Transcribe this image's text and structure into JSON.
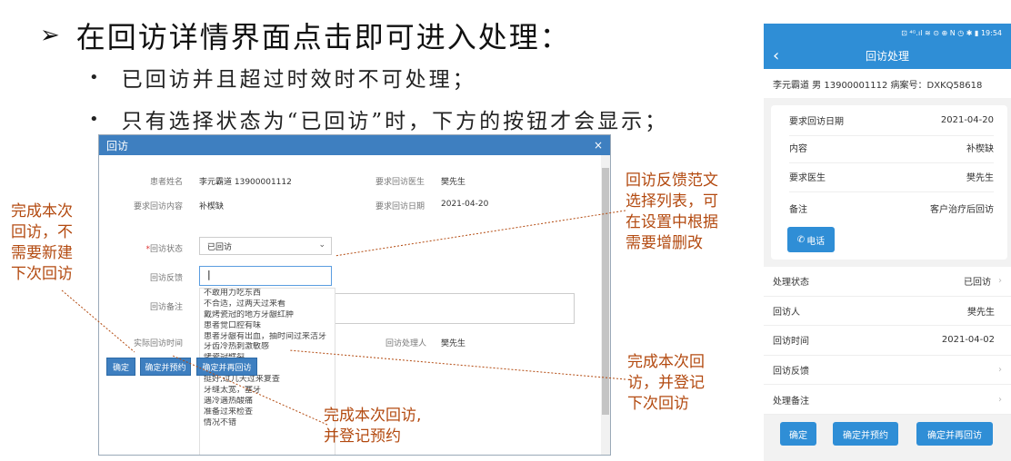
{
  "slide": {
    "heading_arrow": "➢",
    "heading": "在回访详情界面点击即可进入处理：",
    "bullet_symbol": "•",
    "bullets": [
      "已回访并且超过时效时不可处理；",
      "只有选择状态为“已回访”时，下方的按钮才会显示；"
    ]
  },
  "modal": {
    "title": "回访",
    "close": "×",
    "fields": {
      "patient_name_label": "患者姓名",
      "patient_name_value": "李元霸道 13900001112",
      "doctor_label": "要求回访医生",
      "doctor_value": "樊先生",
      "content_label": "要求回访内容",
      "content_value": "补楔缺",
      "date_label": "要求回访日期",
      "date_value": "2021-04-20",
      "status_required": "*",
      "status_label": "回访状态",
      "status_value": "已回访",
      "feedback_label": "回访反馈",
      "feedback_value": "|",
      "remark_label": "回访备注",
      "actual_time_label": "实际回访时间",
      "handler_label": "回访处理人",
      "handler_value": "樊先生"
    },
    "feedback_options": [
      "不敢用力吃东西",
      "不合适，过两天过来看",
      "戴烤瓷冠的地方牙龈红肿",
      "患者觉口腔有味",
      "患者牙龈有出血，抽时间过来洁牙",
      "牙齿冷热刺激敏感",
      "烤瓷冠劈裂",
      "稍微有点痛",
      "挺好,过几天过来复查",
      "牙缝太宽，塞牙",
      "遇冷遇热酸痛",
      "准备过来检查",
      "情况不错"
    ],
    "buttons": {
      "confirm": "确定",
      "confirm_schedule": "确定并预约",
      "confirm_again": "确定并再回访"
    }
  },
  "annotations": {
    "left": [
      "完成本次",
      "回访，不",
      "需要新建",
      "下次回访"
    ],
    "feedback": [
      "回访反馈范文",
      "选择列表，可",
      "在设置中根据",
      "需要增删改"
    ],
    "again": [
      "完成本次回",
      "访，并登记",
      "下次回访"
    ],
    "schedule": [
      "完成本次回访,",
      "并登记预约"
    ]
  },
  "phone": {
    "status_time": "19:54",
    "status_icons": "⊡ ⁴ᴳ.ıl ≋ ⊙      ⊕ N ◷ ✱ ▮ 19:54",
    "title": "回访处理",
    "back": "‹",
    "patient_info": "李元霸道 男 13900001112   病案号：DXKQ58618",
    "card_rows": [
      {
        "label": "要求回访日期",
        "value": "2021-04-20"
      },
      {
        "label": "内容",
        "value": "补楔缺"
      },
      {
        "label": "要求医生",
        "value": "樊先生"
      },
      {
        "label": "备注",
        "value": "客户治疗后回访"
      }
    ],
    "call_button": "电话",
    "list": [
      {
        "label": "处理状态",
        "value": "已回访",
        "chevron": "›"
      },
      {
        "label": "回访人",
        "value": "樊先生",
        "chevron": ""
      },
      {
        "label": "回访时间",
        "value": "2021-04-02",
        "chevron": ""
      },
      {
        "label": "回访反馈",
        "value": "",
        "chevron": "›"
      },
      {
        "label": "处理备注",
        "value": "",
        "chevron": "›"
      }
    ],
    "buttons": {
      "confirm": "确定",
      "confirm_schedule": "确定并预约",
      "confirm_again": "确定并再回访"
    }
  }
}
